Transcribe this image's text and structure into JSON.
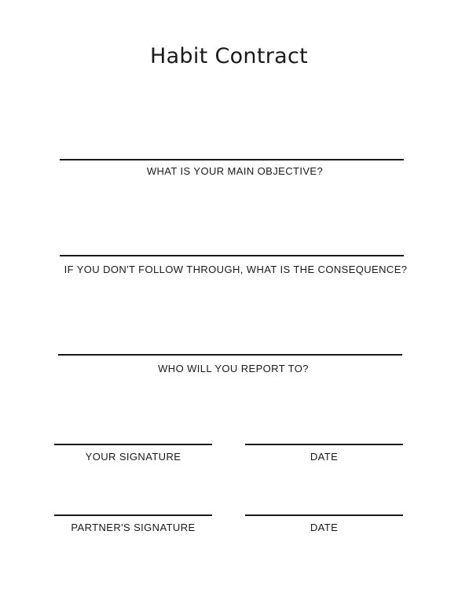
{
  "title": "Habit Contract",
  "fields": {
    "objective": "WHAT IS YOUR MAIN OBJECTIVE?",
    "consequence": "IF YOU DON'T FOLLOW THROUGH, WHAT IS THE CONSEQUENCE?",
    "report_to": "WHO WILL YOU REPORT TO?"
  },
  "signatures": {
    "your_signature": "YOUR SIGNATURE",
    "your_date": "DATE",
    "partner_signature": "PARTNER'S SIGNATURE",
    "partner_date": "DATE"
  }
}
